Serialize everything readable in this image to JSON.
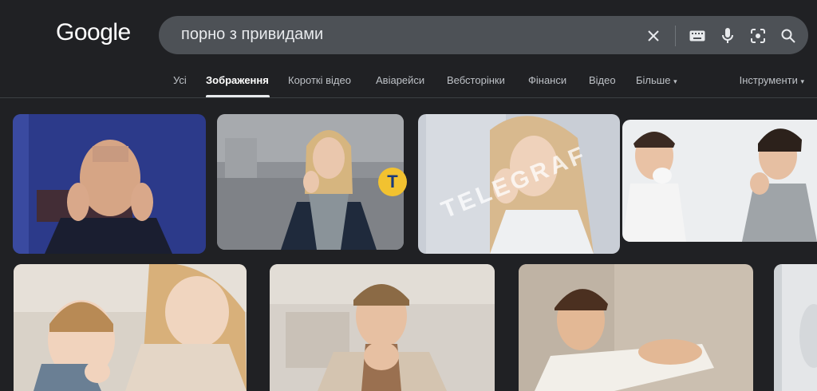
{
  "logo": "Google",
  "search": {
    "query": "порно з привидами"
  },
  "icons": [
    "clear-icon",
    "keyboard-icon",
    "mic-icon",
    "lens-icon",
    "search-icon"
  ],
  "tabs": [
    {
      "label": "Усі"
    },
    {
      "label": "Зображення"
    },
    {
      "label": "Короткі відео"
    },
    {
      "label": "Авіарейси"
    },
    {
      "label": "Вебсторінки"
    },
    {
      "label": "Фінанси"
    },
    {
      "label": "Відео"
    },
    {
      "label": "Більше"
    }
  ],
  "active_tab": "Зображення",
  "tools_label": "Інструменти",
  "results": {
    "watermark": "TELEGRAF",
    "logo_glyph": "T"
  },
  "colors": {
    "background": "#202124",
    "searchbar": "#4d5156",
    "text": "#e8eaed"
  }
}
